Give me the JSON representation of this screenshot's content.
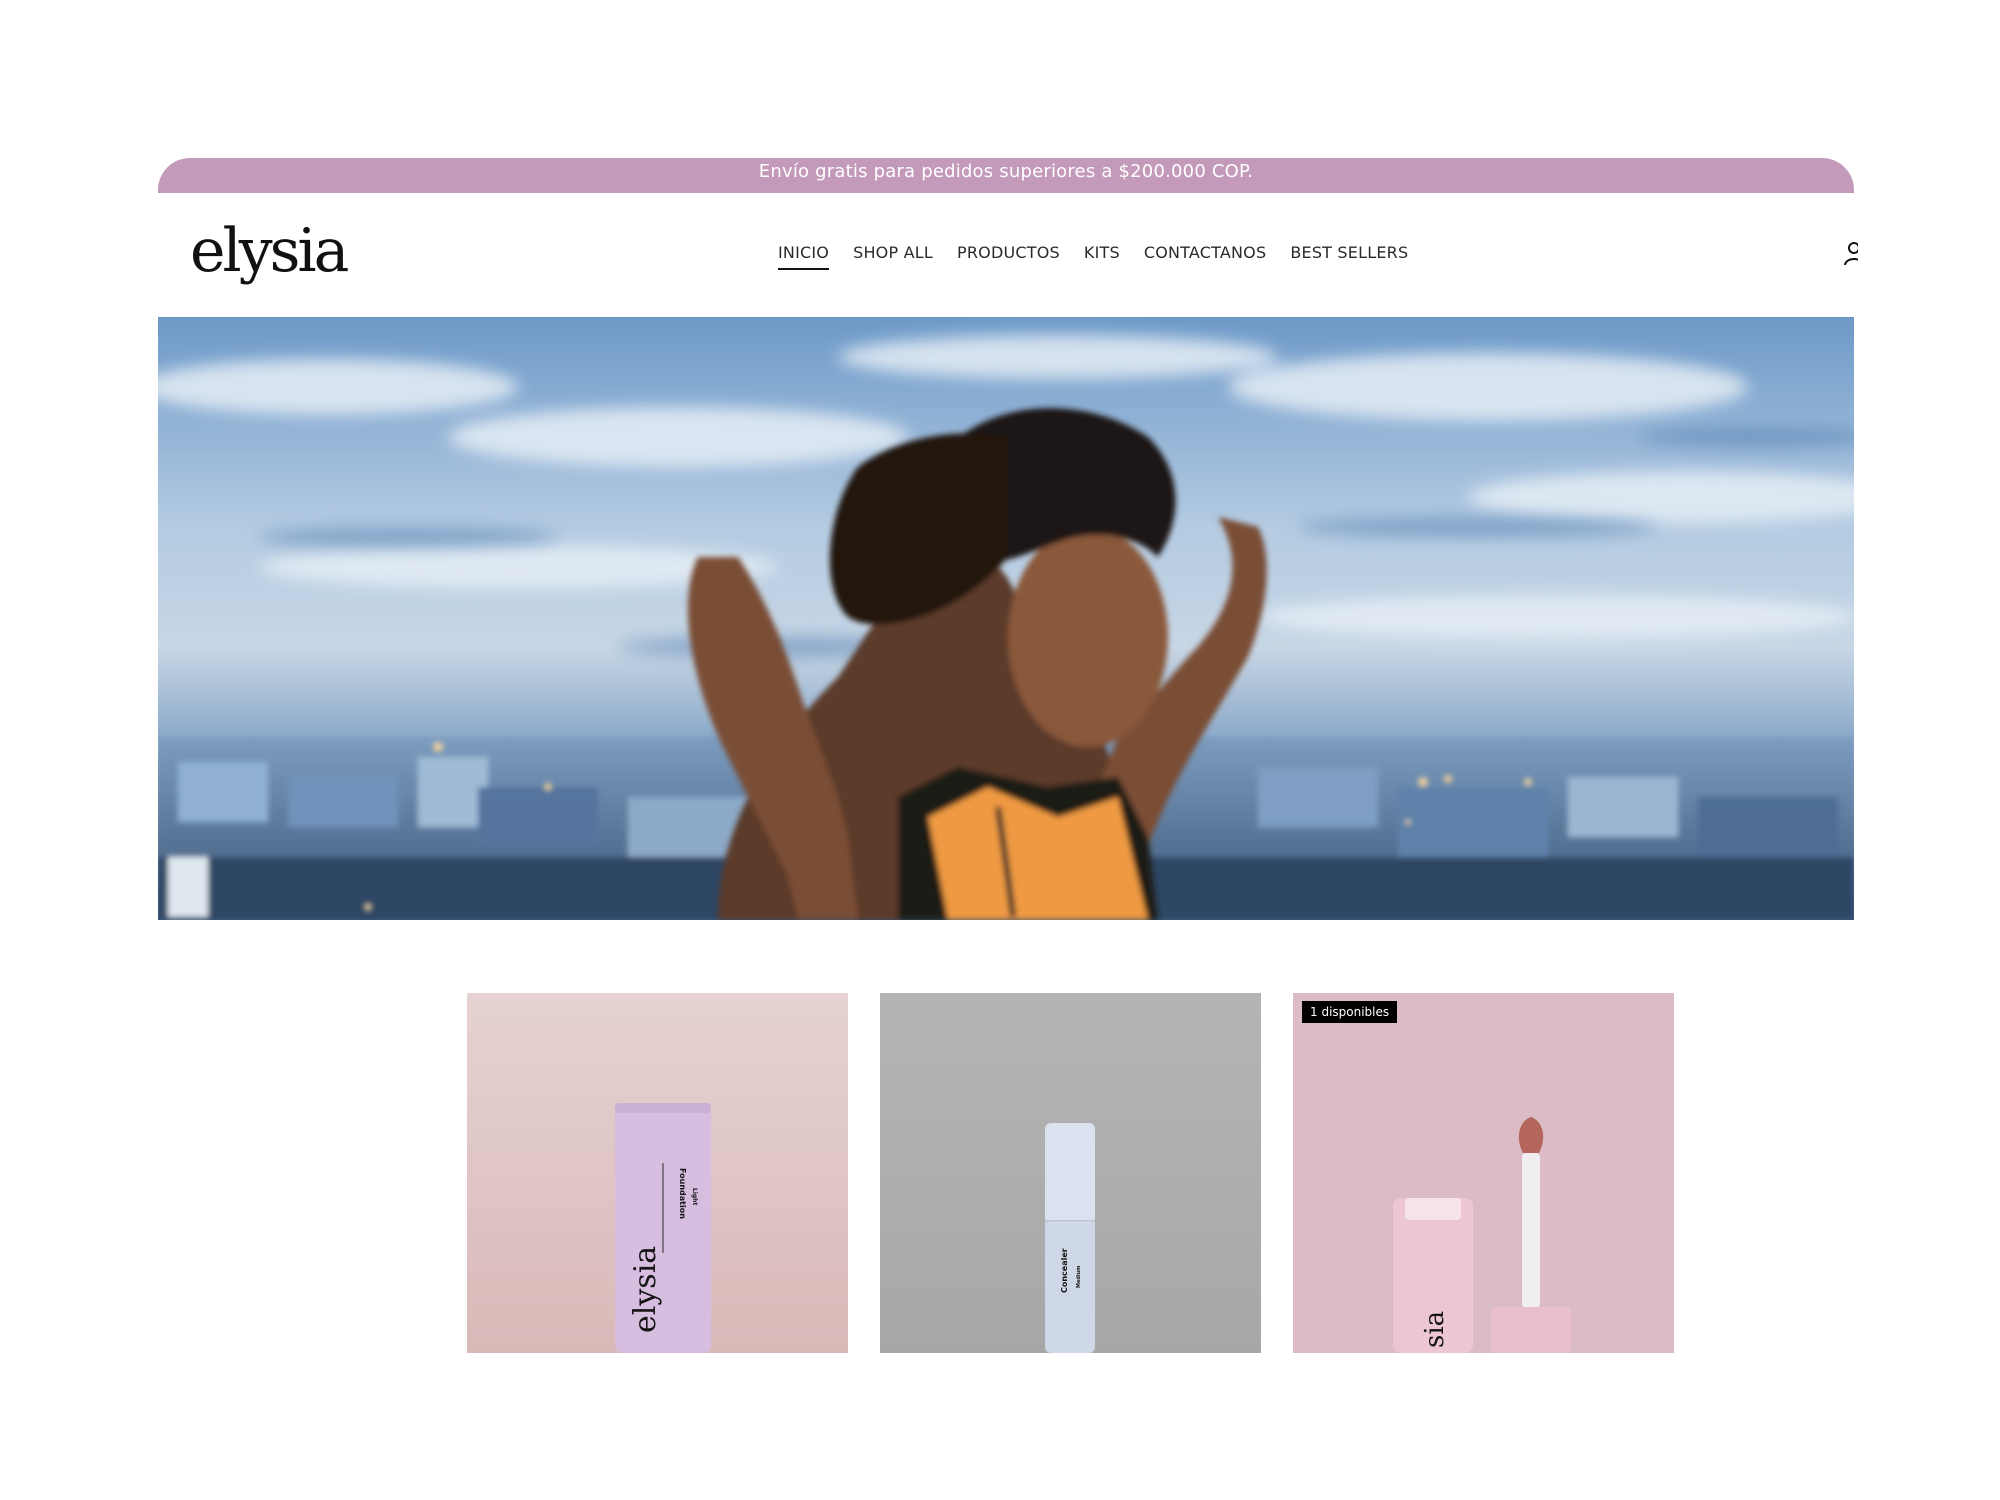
{
  "announcement": {
    "text": "Envío gratis para pedidos superiores a $200.000 COP."
  },
  "header": {
    "logo": "elysia",
    "nav": [
      {
        "label": "INICIO",
        "active": true
      },
      {
        "label": "SHOP ALL",
        "active": false
      },
      {
        "label": "PRODUCTOS",
        "active": false
      },
      {
        "label": "KITS",
        "active": false
      },
      {
        "label": "CONTACTANOS",
        "active": false
      },
      {
        "label": "BEST SELLERS",
        "active": false
      }
    ],
    "account_icon": "user-icon"
  },
  "hero": {
    "image": "woman-rooftop-city-sunset"
  },
  "products": [
    {
      "image": "foundation-tube-lilac",
      "tube_brand": "elysia",
      "tube_product": "Foundation",
      "tube_shade": "Light",
      "badge": ""
    },
    {
      "image": "concealer-tube-blue",
      "tube_product": "Concealer",
      "tube_shade": "Medium",
      "badge": ""
    },
    {
      "image": "lip-gloss-pink",
      "tube_brand": "sia",
      "badge": "1 disponibles"
    }
  ],
  "colors": {
    "announcement_bg": "#c49abb",
    "text": "#2a2a2a",
    "badge_bg": "#000000"
  }
}
